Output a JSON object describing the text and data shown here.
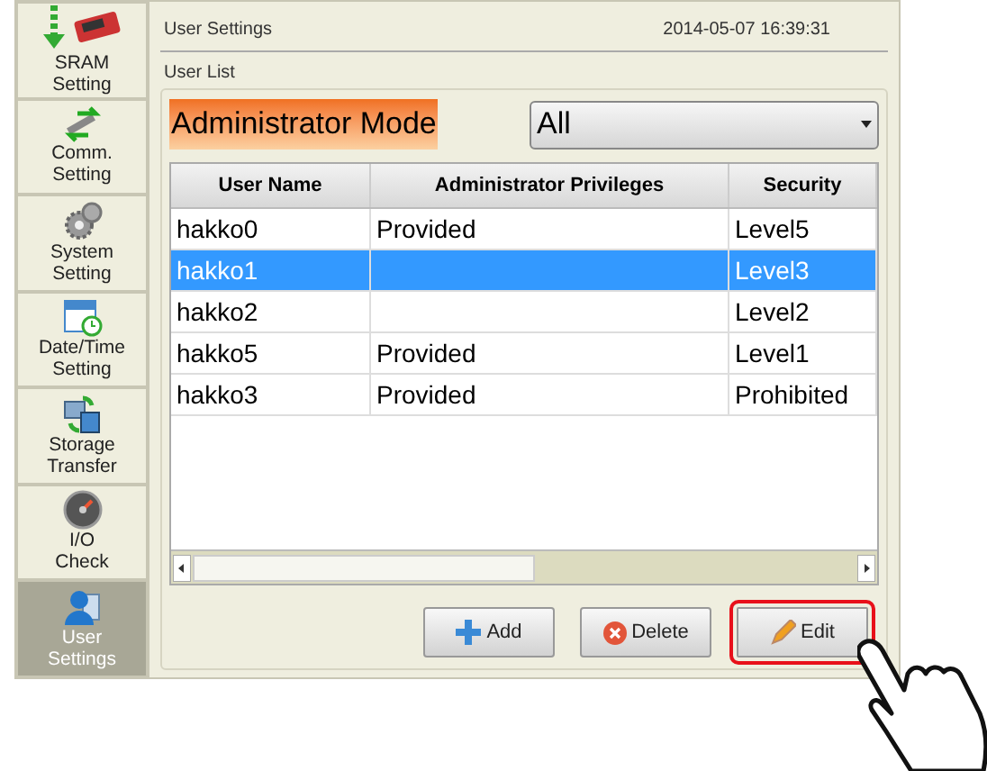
{
  "sidebar": {
    "items": [
      {
        "label": "SRAM\nSetting",
        "selected": false
      },
      {
        "label": "Comm.\nSetting",
        "selected": false
      },
      {
        "label": "System\nSetting",
        "selected": false
      },
      {
        "label": "Date/Time\nSetting",
        "selected": false
      },
      {
        "label": "Storage\nTransfer",
        "selected": false
      },
      {
        "label": "I/O\nCheck",
        "selected": false
      },
      {
        "label": "User\nSettings",
        "selected": true
      }
    ]
  },
  "header": {
    "title": "User Settings",
    "datetime": "2014-05-07  16:39:31"
  },
  "group": {
    "title": "User List",
    "mode_label": "Administrator Mode",
    "filter": {
      "value": "All"
    }
  },
  "table": {
    "columns": [
      "User Name",
      "Administrator Privileges",
      "Security"
    ],
    "rows": [
      {
        "cells": [
          "hakko0",
          "Provided",
          "Level5"
        ],
        "selected": false
      },
      {
        "cells": [
          "hakko1",
          "",
          "Level3"
        ],
        "selected": true
      },
      {
        "cells": [
          "hakko2",
          "",
          "Level2"
        ],
        "selected": false
      },
      {
        "cells": [
          "hakko5",
          "Provided",
          "Level1"
        ],
        "selected": false
      },
      {
        "cells": [
          "hakko3",
          "Provided",
          "Prohibited"
        ],
        "selected": false
      }
    ]
  },
  "buttons": [
    {
      "label": "Add",
      "kind": "add",
      "highlighted": false
    },
    {
      "label": "Delete",
      "kind": "delete",
      "highlighted": false
    },
    {
      "label": "Edit",
      "kind": "edit",
      "highlighted": true
    }
  ]
}
